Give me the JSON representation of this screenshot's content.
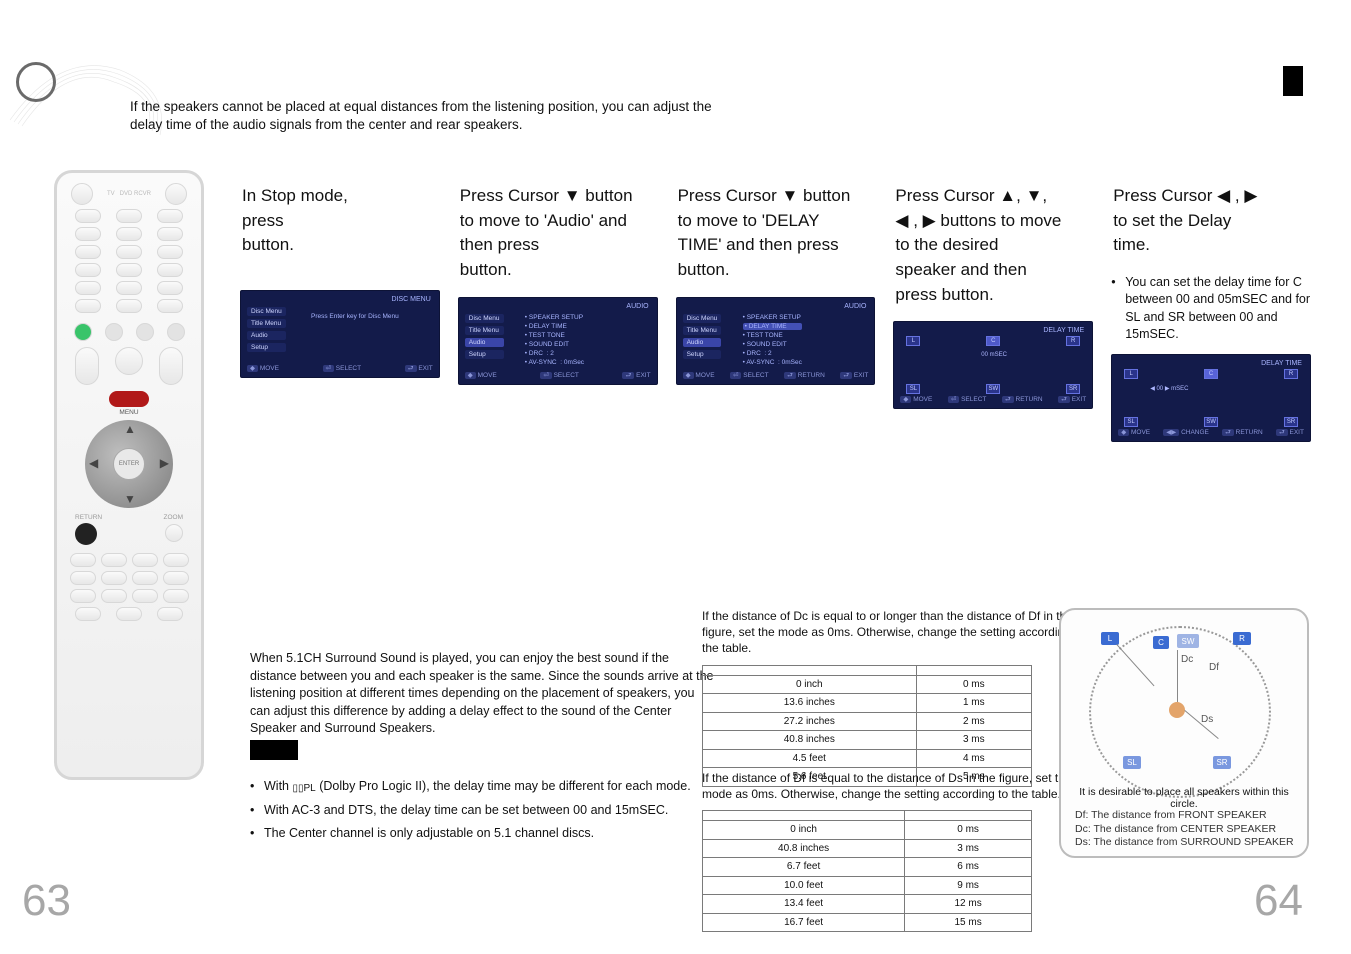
{
  "meta": {
    "intro": "If the speakers cannot be placed at equal distances from the listening position, you can adjust the delay time of the audio signals from the center and rear speakers."
  },
  "remote": {
    "menu_label": "MENU",
    "enter_label": "ENTER",
    "return_label": "RETURN",
    "zoom_label": "ZOOM"
  },
  "steps": {
    "s1": {
      "line1": "In Stop mode,",
      "line2": "press",
      "line3": "button."
    },
    "s2": {
      "line1": "Press Cursor ▼ button",
      "line2": "to move to 'Audio' and",
      "line3": "then press",
      "line4": "button."
    },
    "s3": {
      "line1": "Press Cursor ▼ button",
      "line2": "to move to 'DELAY",
      "line3": "TIME' and then press",
      "line4": "button."
    },
    "s4": {
      "line1": "Press Cursor ▲, ▼,",
      "line2": "◀ , ▶ buttons to move",
      "line3": "to the desired",
      "line4": "speaker and then",
      "line5": "press           button."
    },
    "s5": {
      "line1": "Press Cursor ◀ , ▶",
      "line2": "to set the Delay",
      "line3": "time.",
      "note": "You can set the delay time for C between 00 and 05mSEC and for SL and SR between 00 and 15mSEC."
    }
  },
  "osd_common": {
    "disc_menu": "DISC MENU",
    "audio": "AUDIO",
    "delay_time": "DELAY TIME",
    "left_items": [
      "Disc Menu",
      "Title Menu",
      "Audio",
      "Setup"
    ],
    "audio_items": [
      "SPEAKER SETUP",
      "DELAY TIME",
      "TEST TONE",
      "SOUND EDIT",
      "DRC",
      "AV-SYNC"
    ],
    "drc_val": ": 2",
    "avsync_val": ": 0mSec",
    "hint_move": "MOVE",
    "hint_select": "SELECT",
    "hint_return": "RETURN",
    "hint_exit": "EXIT",
    "hint_change": "CHANGE",
    "press_enter": "Press Enter key for Disc Menu",
    "sp": {
      "L": "L",
      "C": "C",
      "R": "R",
      "SW": "SW",
      "SL": "SL",
      "SR": "SR",
      "ms": "mSEC",
      "val": "00"
    }
  },
  "delay_para": "When 5.1CH Surround Sound is played, you can enjoy the best sound if the distance between you and each speaker is the same. Since the sounds arrive at the listening position at different times depending on the placement of speakers, you can adjust this difference by adding a delay effect to the sound of the Center Speaker and Surround Speakers.",
  "note_bullets": {
    "b1a": "With ",
    "b1b": " (Dolby Pro Logic II), the delay time may be different for each mode.",
    "b2": "With AC-3 and DTS, the delay time can be set between 00 and 15mSEC.",
    "b3": "The Center channel is only adjustable on 5.1 channel discs.",
    "dpl_symbol": "▯▯PL"
  },
  "center": {
    "title": "",
    "desc": "If the distance of Dc is equal to or longer than the distance of Df in the figure, set the mode as 0ms. Otherwise, change the setting according to the table.",
    "table": {
      "rows": [
        [
          "0 inch",
          "0 ms"
        ],
        [
          "13.6 inches",
          "1 ms"
        ],
        [
          "27.2 inches",
          "2 ms"
        ],
        [
          "40.8 inches",
          "3 ms"
        ],
        [
          "4.5 feet",
          "4 ms"
        ],
        [
          "5.6 feet",
          "5 ms"
        ]
      ]
    }
  },
  "rear": {
    "title": "",
    "desc": "If the distance of Df is equal to the distance of Ds in the figure, set the mode as 0ms. Otherwise, change the setting according to the table.",
    "table": {
      "rows": [
        [
          "0 inch",
          "0 ms"
        ],
        [
          "40.8 inches",
          "3 ms"
        ],
        [
          "6.7 feet",
          "6 ms"
        ],
        [
          "10.0 feet",
          "9 ms"
        ],
        [
          "13.4 feet",
          "12 ms"
        ],
        [
          "16.7 feet",
          "15 ms"
        ]
      ]
    }
  },
  "diagram": {
    "L": "L",
    "R": "R",
    "C": "C",
    "SW": "SW",
    "SL": "SL",
    "SR": "SR",
    "Df": "Df",
    "Dc": "Dc",
    "Ds": "Ds",
    "caption": "It is desirable to place all speakers within this circle.",
    "legend1": "Df: The distance from FRONT SPEAKER",
    "legend2": "Dc: The distance from CENTER SPEAKER",
    "legend3": "Ds: The distance from SURROUND SPEAKER"
  },
  "pagenums": {
    "left": "63",
    "right": "64"
  }
}
